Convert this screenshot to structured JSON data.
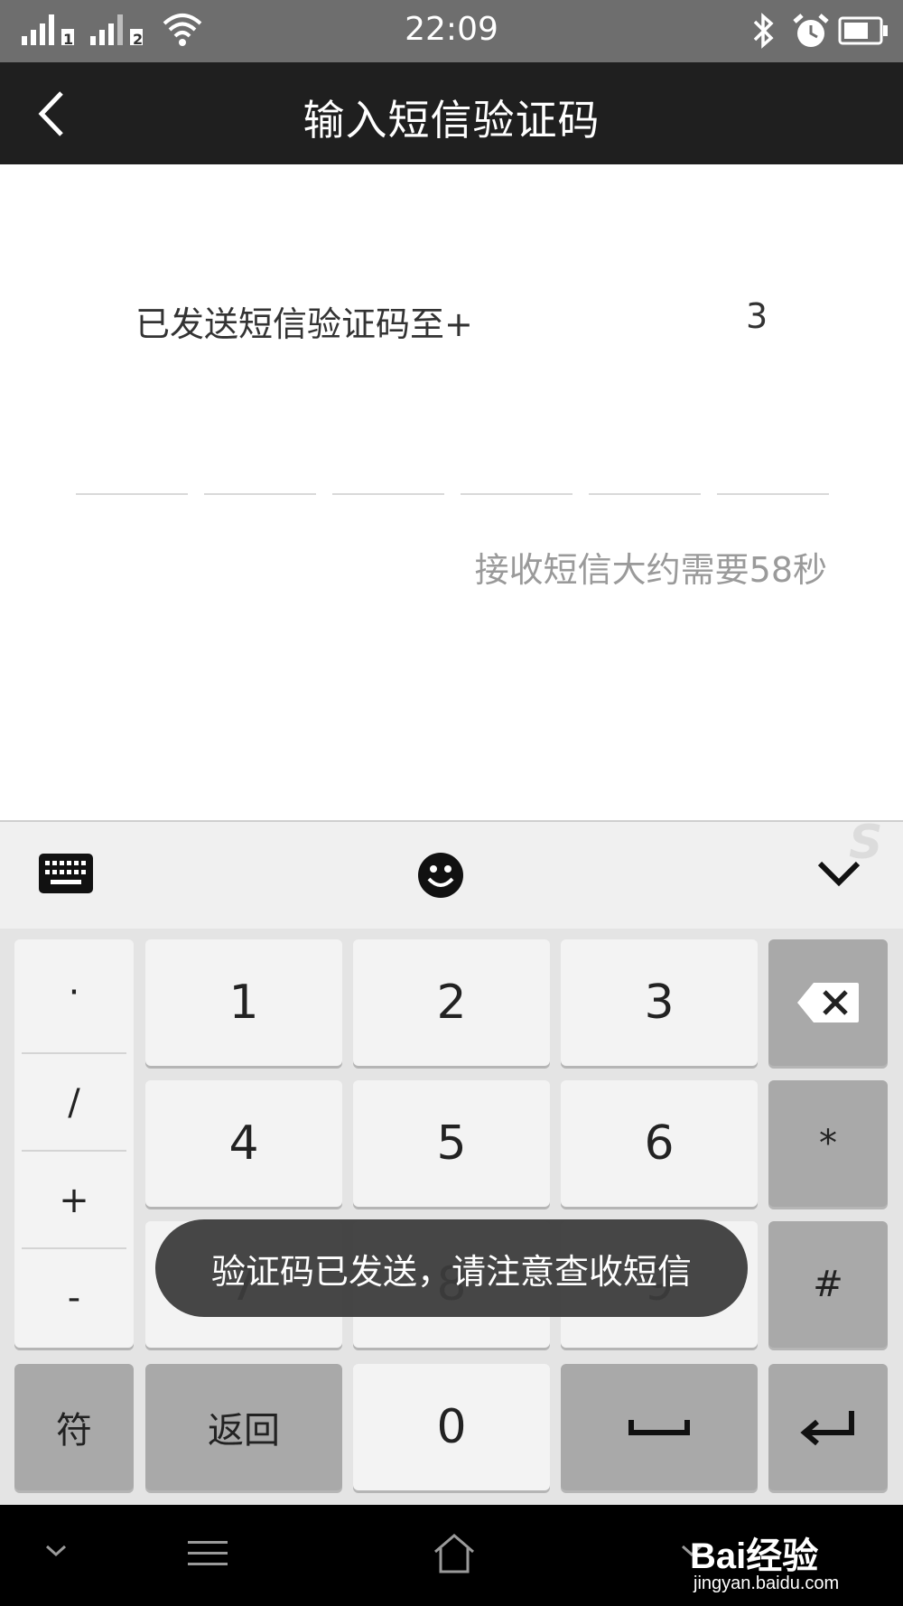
{
  "status_bar": {
    "time": "22:09",
    "sim1": "1",
    "sim2": "2"
  },
  "title_bar": {
    "title": "输入短信验证码"
  },
  "content": {
    "sent_prefix": "已发送短信验证码至+",
    "sent_suffix": "3",
    "code_slots": 6,
    "wait_message": "接收短信大约需要58秒"
  },
  "keyboard": {
    "logo": "S",
    "symbols": [
      "·",
      "/",
      "+",
      "-"
    ],
    "digits": [
      "1",
      "2",
      "3",
      "4",
      "5",
      "6",
      "7",
      "8",
      "9",
      "0"
    ],
    "star": "*",
    "hash": "#",
    "fu": "符",
    "back": "返回"
  },
  "toast": "验证码已发送，请注意查收短信",
  "watermark": {
    "brand": "Bai经验",
    "url": "jingyan.baidu.com"
  },
  "colors": {
    "status_bar": "#6e6e6e",
    "title_bar": "#1f1f1f",
    "toast": "#3c3c3c",
    "keyboard_bg": "#e4e4e4"
  }
}
